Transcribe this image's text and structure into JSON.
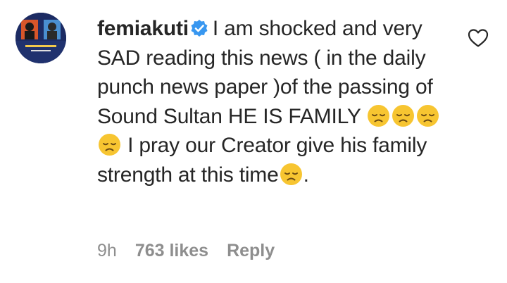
{
  "comment": {
    "username": "femiakuti",
    "verified": true,
    "text_part1": "I am shocked and very SAD reading this news ( in the daily punch news paper )of the passing of Sound Sultan HE IS FAMILY",
    "emoji_run_1": [
      "sad-face-emoji",
      "sad-face-emoji",
      "sad-face-emoji",
      "sad-face-emoji"
    ],
    "text_part2": "I pray our Creator give his family strength at this time",
    "emoji_run_2": [
      "sad-face-emoji"
    ],
    "text_part3": ".",
    "meta": {
      "time": "9h",
      "likes": "763 likes",
      "reply_label": "Reply"
    },
    "icons": {
      "verified": "verified-badge-icon",
      "like": "heart-icon"
    },
    "colors": {
      "verified_blue": "#3897f0",
      "meta_gray": "#8e8e8e",
      "text": "#262626",
      "emoji_yellow": "#f7c531"
    }
  }
}
